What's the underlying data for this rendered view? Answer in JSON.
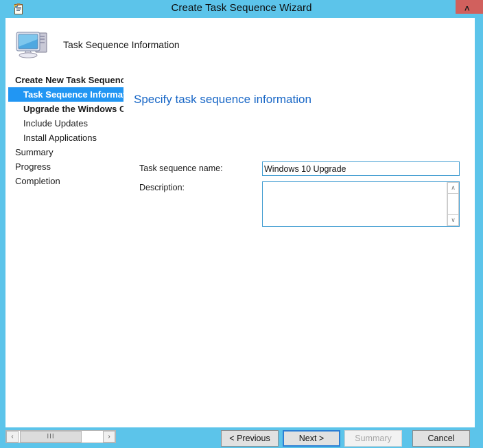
{
  "window": {
    "title": "Create Task Sequence Wizard",
    "icon": "task-clipboard-icon",
    "close_glyph": "˄",
    "frame_color": "#5CC4EA",
    "close_button_color": "#D1605D"
  },
  "header": {
    "icon": "computer-monitor-icon",
    "title": "Task Sequence Information"
  },
  "sidebar": {
    "items": [
      {
        "label": "Create New Task Sequence",
        "level": 0,
        "bold": true,
        "selected": false
      },
      {
        "label": "Task Sequence Information",
        "level": 1,
        "bold": true,
        "selected": true
      },
      {
        "label": "Upgrade the Windows Operating System",
        "level": 1,
        "bold": true,
        "selected": false
      },
      {
        "label": "Include Updates",
        "level": 1,
        "bold": false,
        "selected": false
      },
      {
        "label": "Install Applications",
        "level": 1,
        "bold": false,
        "selected": false
      },
      {
        "label": "Summary",
        "level": 0,
        "bold": false,
        "selected": false
      },
      {
        "label": "Progress",
        "level": 0,
        "bold": false,
        "selected": false
      },
      {
        "label": "Completion",
        "level": 0,
        "bold": false,
        "selected": false
      }
    ],
    "selected_color": "#2196F3"
  },
  "main": {
    "heading": "Specify task sequence information",
    "heading_color": "#1766C6",
    "fields": {
      "name_label": "Task sequence name:",
      "name_value": "Windows 10 Upgrade",
      "name_placeholder": "",
      "description_label": "Description:",
      "description_value": "",
      "description_placeholder": ""
    },
    "scrollbar": {
      "up_glyph": "∧",
      "down_glyph": "∨"
    }
  },
  "footer": {
    "previous_label": "< Previous",
    "next_label": "Next >",
    "summary_label": "Summary",
    "cancel_label": "Cancel",
    "summary_disabled": true,
    "next_is_default": true
  },
  "bottom_scrollbar": {
    "left_glyph": "‹",
    "right_glyph": "›",
    "thumb_grip": "III"
  }
}
